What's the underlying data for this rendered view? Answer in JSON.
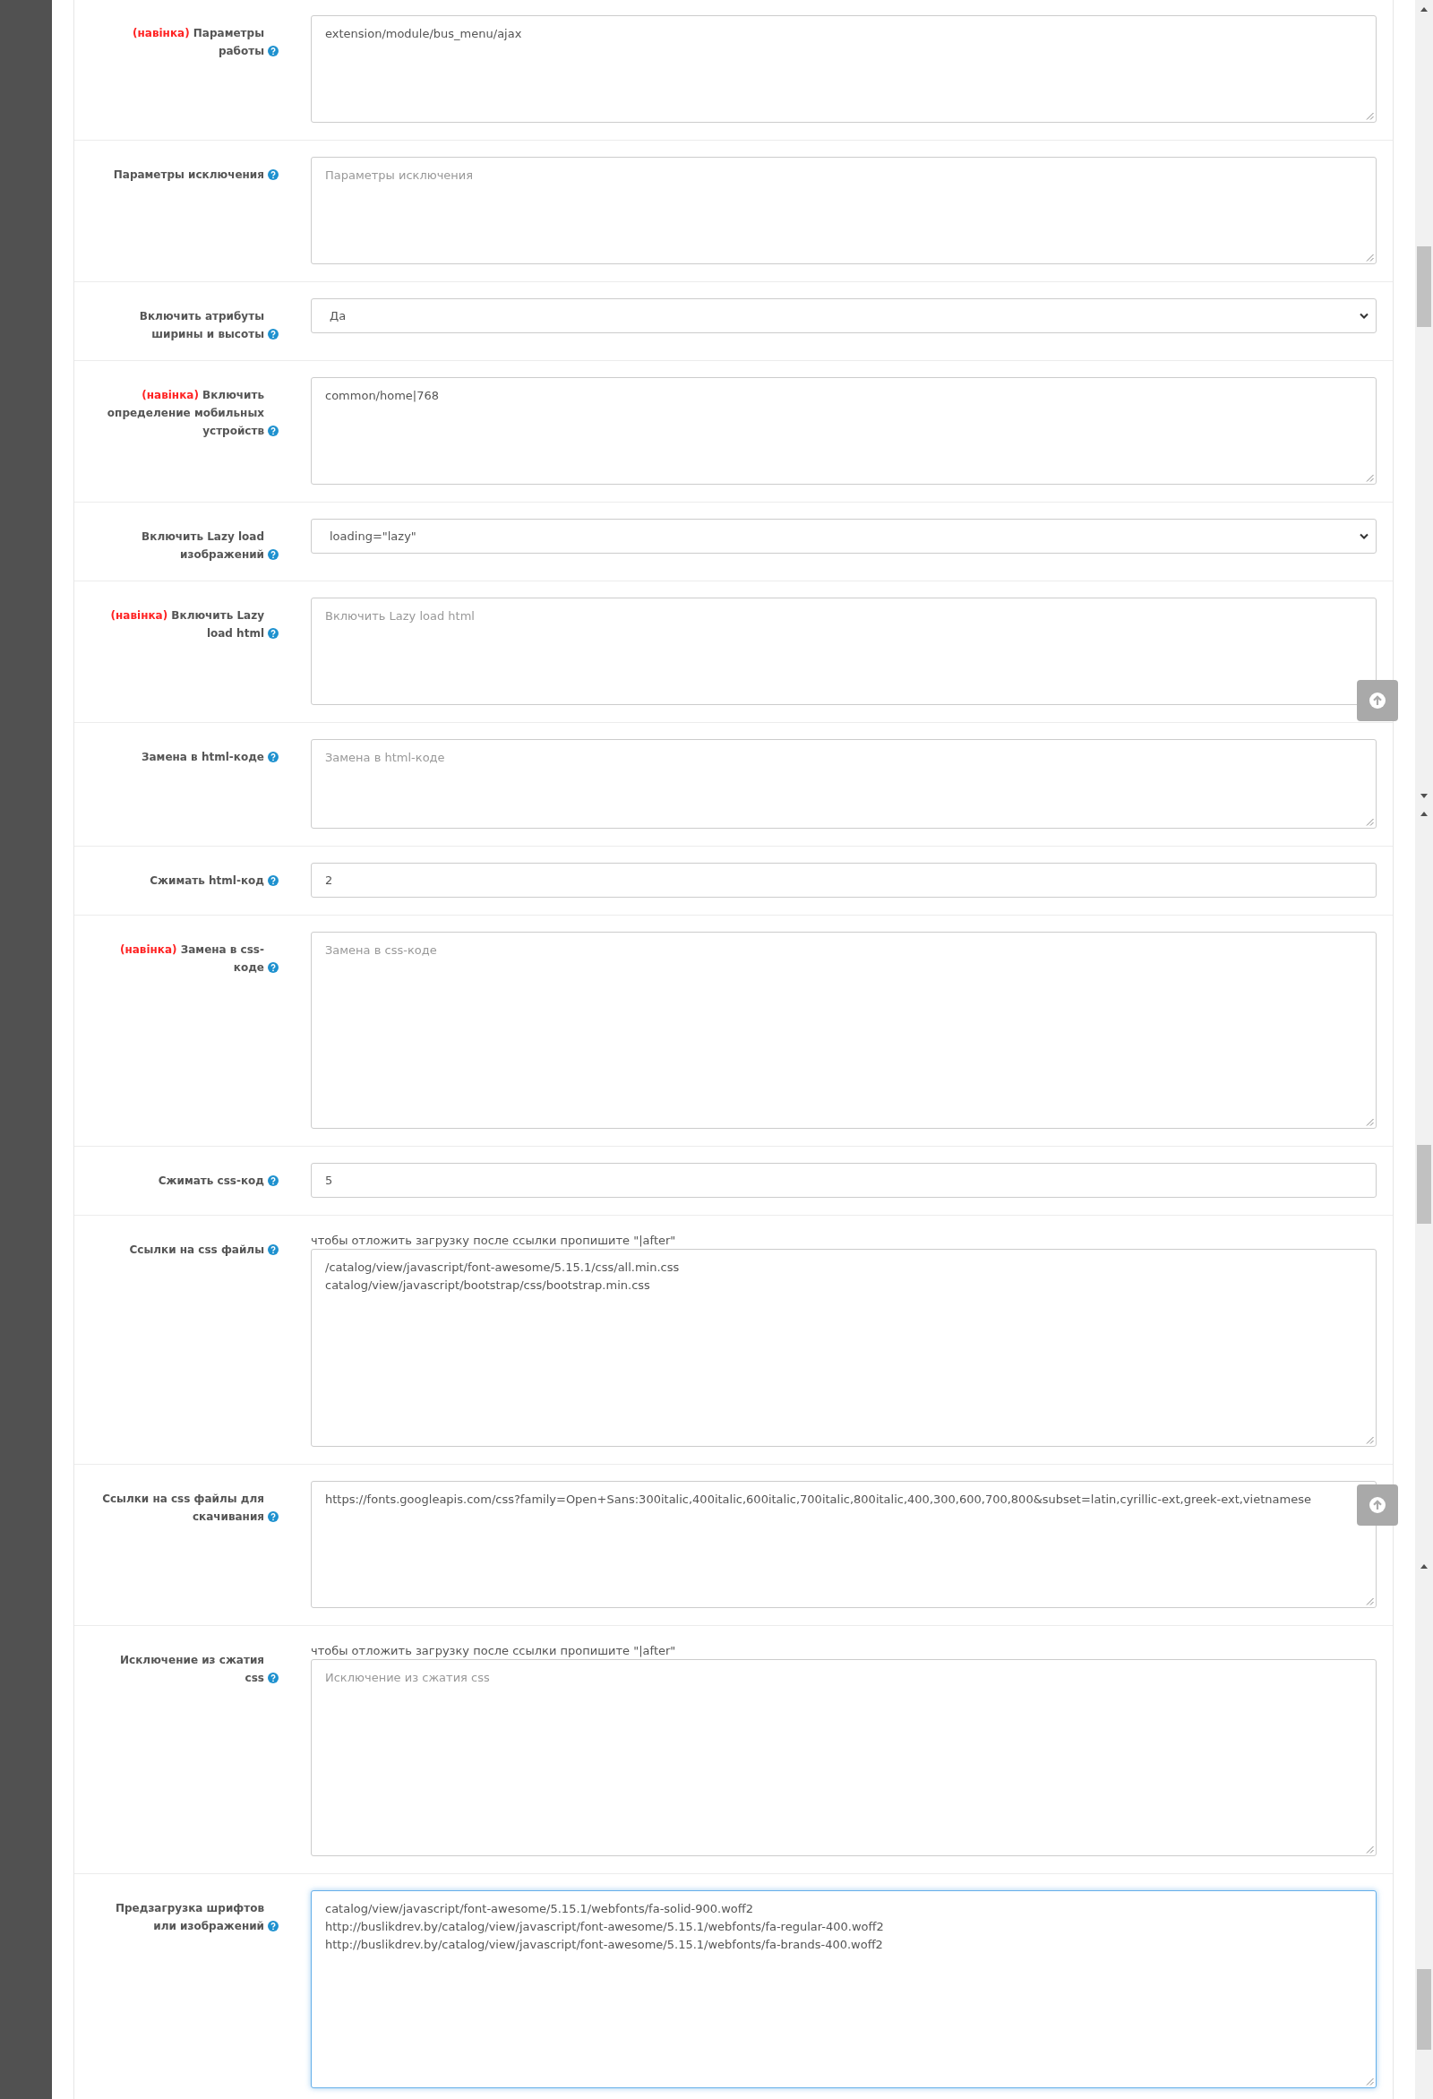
{
  "form": {
    "fields": [
      {
        "kind": "textarea",
        "tag": "(навінка)",
        "label": "Параметры работы",
        "value": "extension/module/bus_menu/ajax",
        "focused": false
      },
      {
        "kind": "textarea",
        "label": "Параметры исключения",
        "placeholder": "Параметры исключения",
        "focused": false
      },
      {
        "kind": "select",
        "label": "Включить атрибуты ширины и высоты",
        "value": "Да",
        "focused": false
      },
      {
        "kind": "textarea",
        "tag": "(навінка)",
        "label": "Включить определение мобильных устройств",
        "value": "common/home|768",
        "focused": false
      },
      {
        "kind": "select",
        "label": "Включить Lazy load изображений",
        "value": "loading=\"lazy\"",
        "focused": false
      },
      {
        "kind": "textarea",
        "tag": "(навінка)",
        "label": "Включить Lazy load html",
        "placeholder": "Включить Lazy load html",
        "focused": false
      },
      {
        "kind": "textarea",
        "label": "Замена в html-коде",
        "placeholder": "Замена в html-коде",
        "focused": false
      },
      {
        "kind": "input",
        "label": "Сжимать html-код",
        "value": "2",
        "focused": false
      },
      {
        "kind": "textarea",
        "tag": "(навінка)",
        "label": "Замена в css-коде",
        "placeholder": "Замена в css-коде",
        "focused": false
      },
      {
        "kind": "input",
        "label": "Сжимать css-код",
        "value": "5",
        "focused": false
      },
      {
        "kind": "textarea",
        "label": "Ссылки на css файлы",
        "help_text": "чтобы отложить загрузку после ссылки пропишите \"|after\"",
        "value": "/catalog/view/javascript/font-awesome/5.15.1/css/all.min.css\ncatalog/view/javascript/bootstrap/css/bootstrap.min.css",
        "focused": false
      },
      {
        "kind": "textarea",
        "label": "Ссылки на css файлы для скачивания",
        "value": "https://fonts.googleapis.com/css?family=Open+Sans:300italic,400italic,600italic,700italic,800italic,400,300,600,700,800&subset=latin,cyrillic-ext,greek-ext,vietnamese",
        "focused": false
      },
      {
        "kind": "textarea",
        "label": "Исключение из сжатия css",
        "help_text": "чтобы отложить загрузку после ссылки пропишите \"|after\"",
        "placeholder": "Исключение из сжатия css",
        "focused": false
      },
      {
        "kind": "textarea",
        "label": "Предзагрузка шрифтов или изображений",
        "value": "catalog/view/javascript/font-awesome/5.15.1/webfonts/fa-solid-900.woff2\nhttp://buslikdrev.by/catalog/view/javascript/font-awesome/5.15.1/webfonts/fa-regular-400.woff2\nhttp://buslikdrev.by/catalog/view/javascript/font-awesome/5.15.1/webfonts/fa-brands-400.woff2",
        "focused": true
      }
    ]
  }
}
